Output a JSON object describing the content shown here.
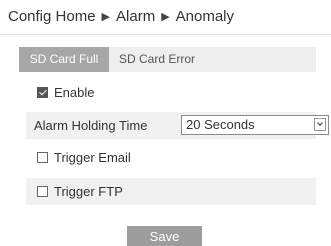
{
  "breadcrumb": {
    "items": [
      "Config Home",
      "Alarm",
      "Anomaly"
    ],
    "separator": "▶"
  },
  "tabs": [
    {
      "label": "SD Card Full",
      "active": true
    },
    {
      "label": "SD Card Error",
      "active": false
    }
  ],
  "form": {
    "enable_label": "Enable",
    "enable_checked": true,
    "holding_time_label": "Alarm Holding Time",
    "holding_time_value": "20 Seconds",
    "trigger_email_label": "Trigger Email",
    "trigger_email_checked": false,
    "trigger_ftp_label": "Trigger FTP",
    "trigger_ftp_checked": false
  },
  "save_label": "Save",
  "colors": {
    "active_tab": "#a7a7a7",
    "tab_bar": "#eeeeee",
    "row_shade": "#f1f1f1",
    "save_button": "#9d9d9d"
  }
}
